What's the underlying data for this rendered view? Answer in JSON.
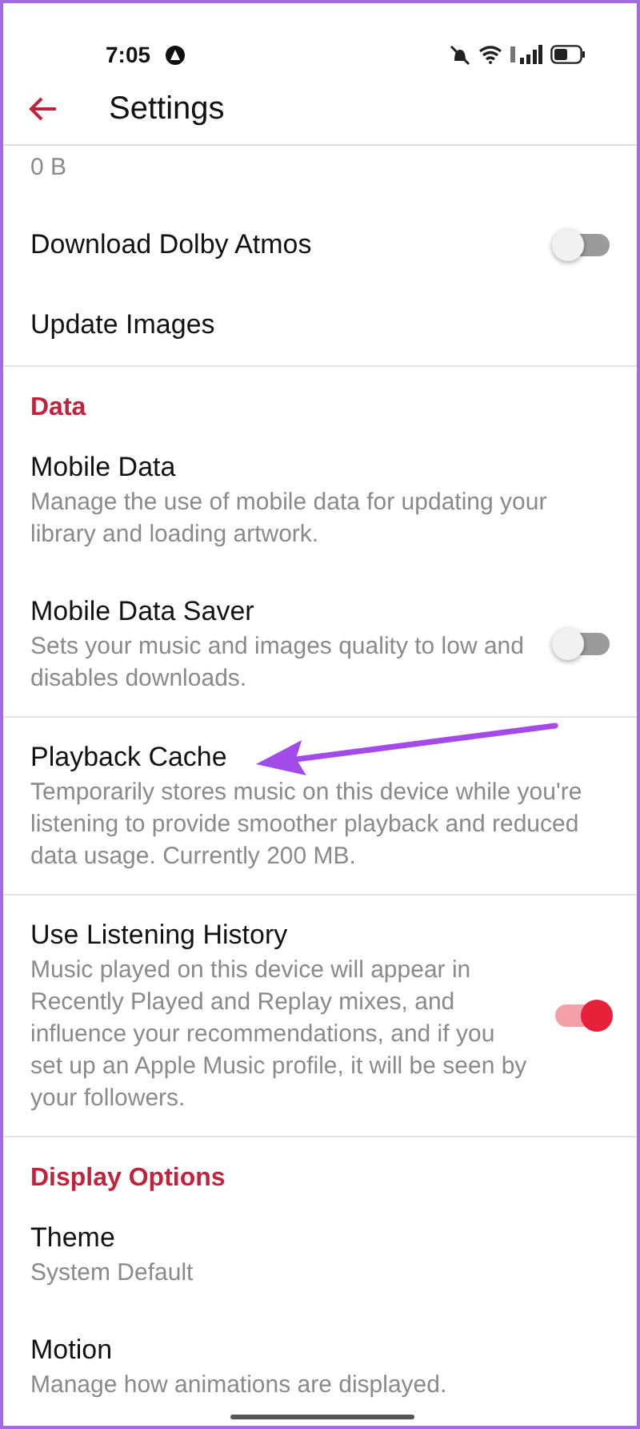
{
  "status_bar": {
    "time": "7:05"
  },
  "header": {
    "title": "Settings"
  },
  "sections": [
    {
      "items": [
        {
          "kind": "plain",
          "subtitle": "0 B"
        },
        {
          "kind": "toggle",
          "title": "Download Dolby Atmos",
          "on": false
        },
        {
          "kind": "plain",
          "title": "Update Images"
        }
      ]
    },
    {
      "heading": "Data",
      "items": [
        {
          "kind": "plain",
          "title": "Mobile Data",
          "subtitle": "Manage the use of mobile data for updating your library and loading artwork."
        },
        {
          "kind": "toggle",
          "title": "Mobile Data Saver",
          "subtitle": "Sets your music and images quality to low and disables downloads.",
          "on": false
        }
      ]
    },
    {
      "items": [
        {
          "kind": "plain",
          "title": "Playback Cache",
          "subtitle": "Temporarily stores music on this device while you're listening to provide smoother playback and reduced data usage. Currently 200 MB.",
          "annotated": true
        }
      ]
    },
    {
      "items": [
        {
          "kind": "toggle",
          "title": "Use Listening History",
          "subtitle": "Music played on this device will appear in Recently Played and Replay mixes, and influence your recommendations, and if you set up an Apple Music profile, it will be seen by your followers.",
          "on": true
        }
      ]
    },
    {
      "heading": "Display Options",
      "items": [
        {
          "kind": "plain",
          "title": "Theme",
          "subtitle": "System Default"
        },
        {
          "kind": "plain",
          "title": "Motion",
          "subtitle": "Manage how animations are displayed."
        }
      ]
    }
  ]
}
